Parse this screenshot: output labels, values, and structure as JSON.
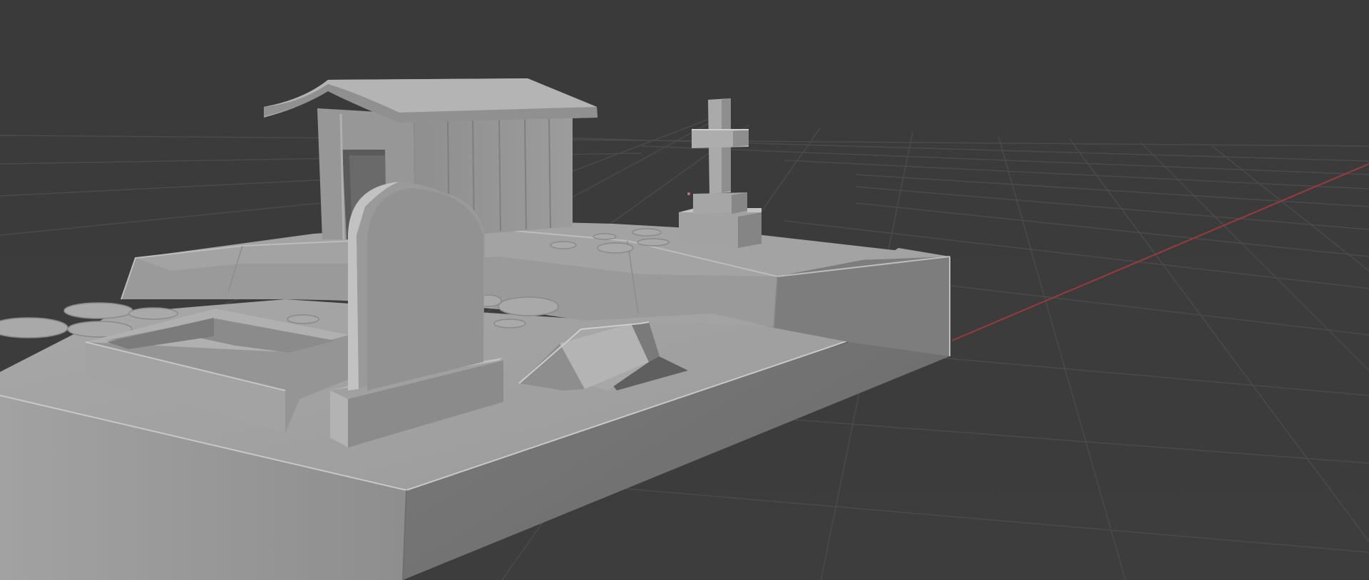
{
  "viewport": {
    "name": "3D Viewport",
    "shading_mode": "solid",
    "background_color": "#3b3b3b",
    "grid_line_color": "#4a4a4a",
    "grid_visible": true,
    "x_axis_color": "#9a3a3a",
    "object_color": "#a8a8a8"
  },
  "scene": {
    "objects": [
      "ground-base",
      "crypt-shed",
      "cross-gravestone",
      "rounded-tombstone",
      "open-grave",
      "broken-coffin",
      "stepping-stones"
    ]
  }
}
